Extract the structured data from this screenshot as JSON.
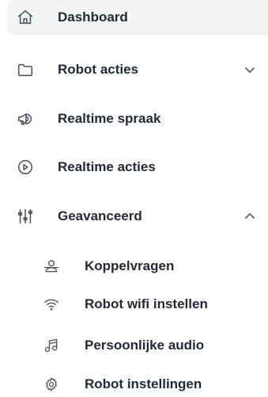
{
  "nav": {
    "dashboard": {
      "label": "Dashboard",
      "icon": "home-icon",
      "active": true
    },
    "robot_acties": {
      "label": "Robot acties",
      "icon": "folder-icon",
      "expanded": false
    },
    "realtime_spraak": {
      "label": "Realtime spraak",
      "icon": "megaphone-icon"
    },
    "realtime_acties": {
      "label": "Realtime acties",
      "icon": "play-circle-icon"
    },
    "geavanceerd": {
      "label": "Geavanceerd",
      "icon": "sliders-icon",
      "expanded": true,
      "children": [
        {
          "label": "Koppelvragen",
          "icon": "users-icon"
        },
        {
          "label": "Robot wifi instellen",
          "icon": "wifi-icon"
        },
        {
          "label": "Persoonlijke audio",
          "icon": "music-icon"
        },
        {
          "label": "Robot instellingen",
          "icon": "gear-icon"
        }
      ]
    }
  },
  "colors": {
    "active_bg": "#f3f4f6",
    "text": "#1f2937",
    "icon": "#4b5563",
    "chevron": "#6b7280"
  }
}
